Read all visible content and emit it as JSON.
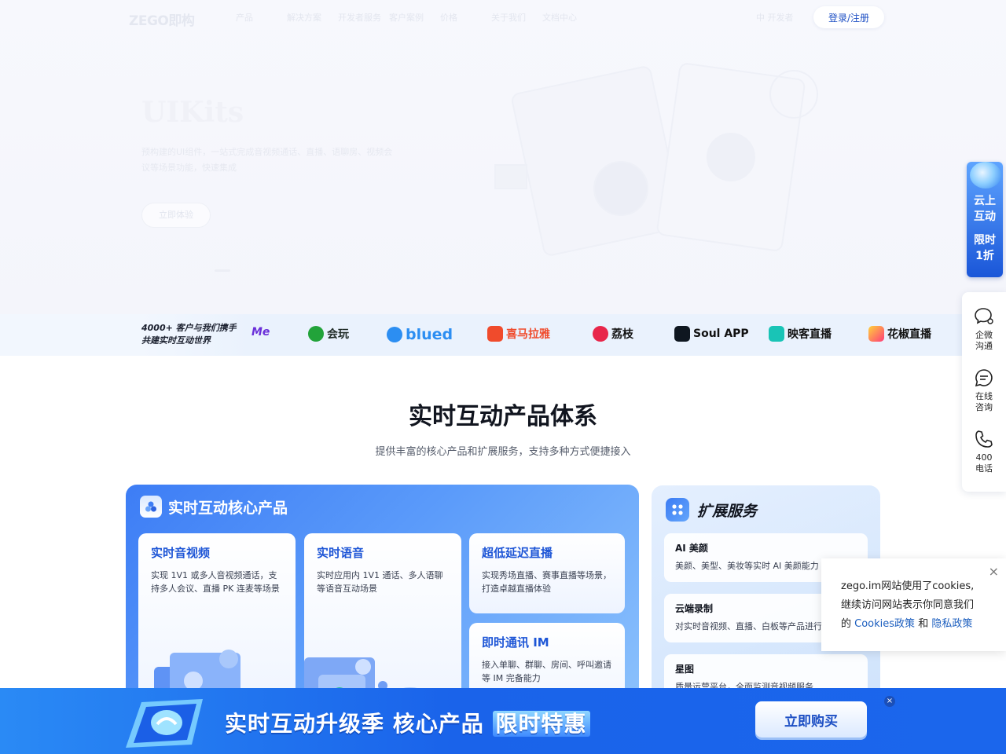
{
  "nav": {
    "logo": "ZEGO即构",
    "items": [
      "产品",
      "解决方案",
      "开发者服务",
      "客户案例",
      "价格",
      "关于我们",
      "文档中心"
    ],
    "lang": "中 开发者",
    "login": "登录/注册"
  },
  "hero": {
    "title": "UIKits",
    "desc": "预构建的UI组件，一站式完成音视频通话、直播、语聊房、视频会议等场景功能，快速集成",
    "button": "立即体验"
  },
  "customers": {
    "intro_line1": "4000+ 客户与我们携手",
    "intro_line2": "共建实时互动世界",
    "logos": [
      {
        "name": "Me",
        "color": "#6a2fd9"
      },
      {
        "name": "会玩",
        "color": "#22a33a"
      },
      {
        "name": "blued",
        "color": "#2c8ef2"
      },
      {
        "name": "喜马拉雅",
        "color": "#f04b2c"
      },
      {
        "name": "荔枝",
        "color": "#e8264a"
      },
      {
        "name": "Soul APP",
        "color": "#0f1720"
      },
      {
        "name": "映客直播",
        "color": "#19c4b6"
      },
      {
        "name": "花椒直播",
        "color": "#ff3d7a"
      }
    ]
  },
  "section": {
    "title": "实时互动产品体系",
    "subtitle": "提供丰富的核心产品和扩展服务，支持多种方式便捷接入"
  },
  "core": {
    "title": "实时互动核心产品",
    "cards": [
      {
        "title": "实时音视频",
        "desc": "实现 1V1 或多人音视频通话，支持多人会议、直播 PK 连麦等场景"
      },
      {
        "title": "实时语音",
        "desc": "实时应用内 1V1 通话、多人语聊等语音互动场景"
      },
      {
        "title": "超低延迟直播",
        "desc": "实现秀场直播、赛事直播等场景，打造卓越直播体验"
      },
      {
        "title": "即时通讯 IM",
        "desc": "接入单聊、群聊、房间、呼叫邀请等 IM 完备能力"
      }
    ]
  },
  "ext": {
    "title": "扩展服务",
    "cards": [
      {
        "title": "AI 美颜",
        "desc": "美颜、美型、美妆等实时 AI 美颜能力"
      },
      {
        "title": "云端录制",
        "desc": "对实时音视频、直播、白板等产品进行"
      },
      {
        "title": "星图",
        "desc": "质量运营平台，全面监测音视频服务"
      }
    ]
  },
  "promo_side": {
    "line1": "云上",
    "line2": "互动",
    "line3": "限时",
    "line4": "1折"
  },
  "tools": [
    {
      "line1": "企微",
      "line2": "沟通"
    },
    {
      "line1": "在线",
      "line2": "咨询"
    },
    {
      "line1": "400",
      "line2": "电话"
    }
  ],
  "cookie": {
    "text1": "zego.im网站使用了cookies,",
    "text2": "继续访问网站表示你同意我们",
    "text3_prefix": "的",
    "cookies_link": "Cookies政策",
    "and": "和",
    "privacy_link": "隐私政策"
  },
  "banner": {
    "text_main": "实时互动升级季 核心产品",
    "text_highlight": "限时特惠",
    "button": "立即购买",
    "close": "×"
  },
  "colors": {
    "brand": "#1d55d6",
    "banner": "#1a63ea"
  }
}
